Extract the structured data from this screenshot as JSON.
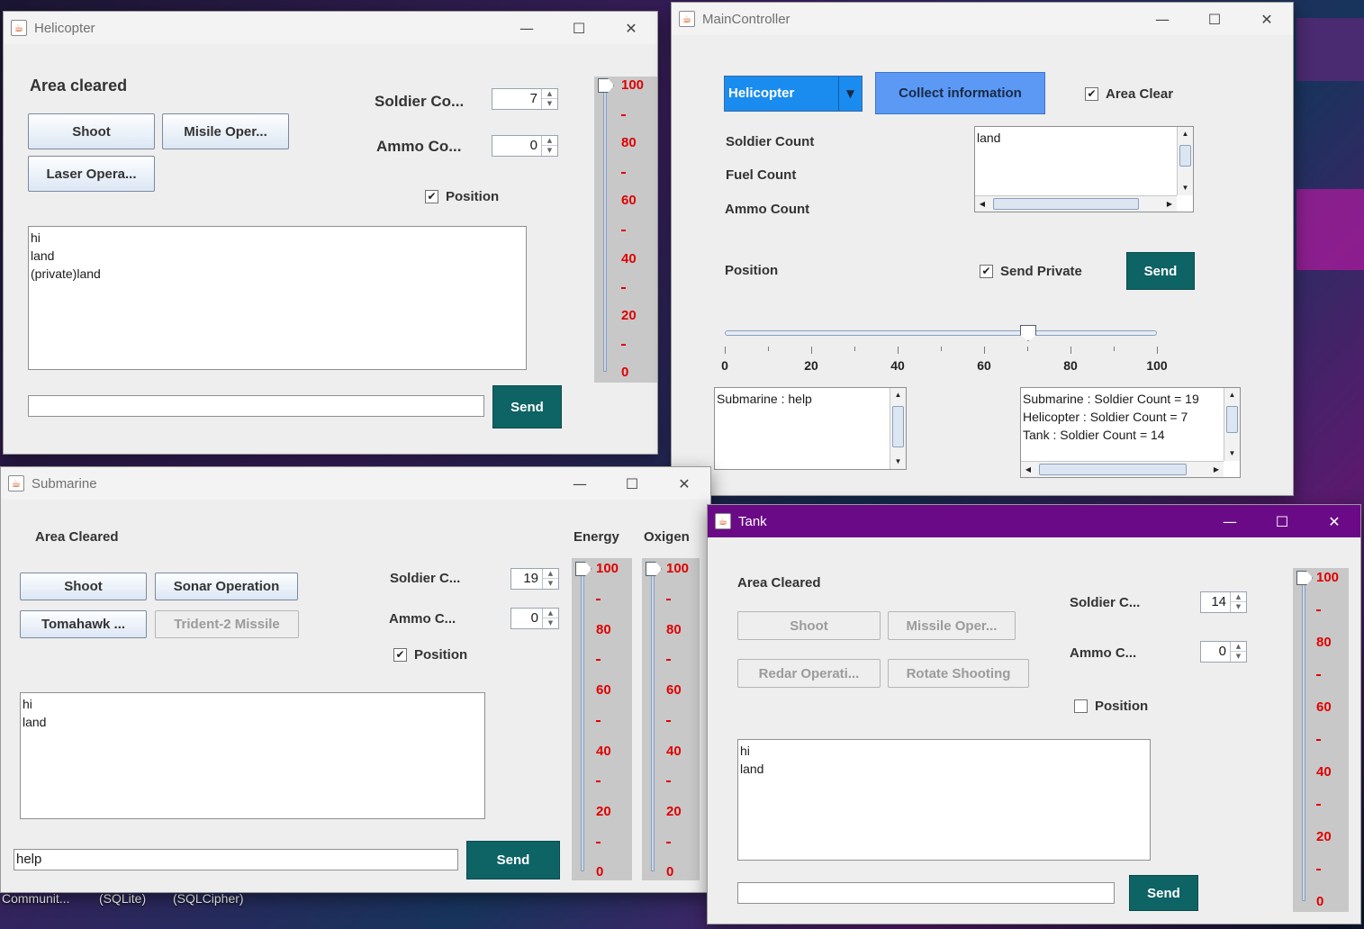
{
  "desktop": {
    "taskbar_labels": [
      "Communit...",
      "(SQLite)",
      "(SQLCipher)"
    ]
  },
  "helicopter": {
    "title": "Helicopter",
    "status": "Area cleared",
    "buttons": {
      "shoot": "Shoot",
      "missile": "Misile Oper...",
      "laser": "Laser Opera..."
    },
    "soldier_label": "Soldier Co...",
    "soldier_value": "7",
    "ammo_label": "Ammo Co...",
    "ammo_value": "0",
    "position_label": "Position",
    "position_checked": true,
    "log": [
      "hi",
      "land",
      "(private)land"
    ],
    "input_value": "",
    "send": "Send",
    "slider": {
      "ticks": [
        "100",
        "80",
        "60",
        "40",
        "20",
        "0"
      ],
      "value": 100
    }
  },
  "controller": {
    "title": "MainController",
    "combo_value": "Helicopter",
    "collect_button": "Collect information",
    "area_clear_label": "Area Clear",
    "area_clear_checked": true,
    "soldier_count_label": "Soldier Count",
    "fuel_count_label": "Fuel Count",
    "ammo_count_label": "Ammo Count",
    "info_text": "land",
    "position_label": "Position",
    "send_private_label": "Send Private",
    "send_private_checked": true,
    "send": "Send",
    "position_slider": {
      "ticks": [
        "0",
        "20",
        "40",
        "60",
        "80",
        "100"
      ],
      "value": 70
    },
    "messages": [
      "Submarine : help"
    ],
    "counts": [
      "Submarine : Soldier Count = 19",
      "Helicopter : Soldier Count = 7",
      "Tank : Soldier Count = 14"
    ]
  },
  "submarine": {
    "title": "Submarine",
    "status": "Area Cleared",
    "energy_label": "Energy",
    "oxigen_label": "Oxigen",
    "buttons": {
      "shoot": "Shoot",
      "sonar": "Sonar Operation",
      "tomahawk": "Tomahawk ...",
      "trident": "Trident-2 Missile"
    },
    "soldier_label": "Soldier C...",
    "soldier_value": "19",
    "ammo_label": "Ammo C...",
    "ammo_value": "0",
    "position_label": "Position",
    "position_checked": true,
    "log": [
      "hi",
      "land"
    ],
    "input_value": "help",
    "send": "Send",
    "energy_slider": {
      "ticks": [
        "100",
        "80",
        "60",
        "40",
        "20",
        "0"
      ],
      "value": 100
    },
    "oxigen_slider": {
      "ticks": [
        "100",
        "80",
        "60",
        "40",
        "20",
        "0"
      ],
      "value": 100
    }
  },
  "tank": {
    "title": "Tank",
    "status": "Area Cleared",
    "buttons": {
      "shoot": "Shoot",
      "missile": "Missile Oper...",
      "redar": "Redar Operati...",
      "rotate": "Rotate Shooting"
    },
    "soldier_label": "Soldier C...",
    "soldier_value": "14",
    "ammo_label": "Ammo C...",
    "ammo_value": "0",
    "position_label": "Position",
    "position_checked": false,
    "log": [
      "hi",
      "land"
    ],
    "input_value": "",
    "send": "Send",
    "slider": {
      "ticks": [
        "100",
        "80",
        "60",
        "40",
        "20",
        "0"
      ],
      "value": 100
    }
  },
  "colors": {
    "send_button": "#0e6365",
    "slider_tick": "#e00000",
    "active_title": "#6b0a87",
    "combo": "#1a8cf0",
    "collect_button": "#5b99f5"
  }
}
